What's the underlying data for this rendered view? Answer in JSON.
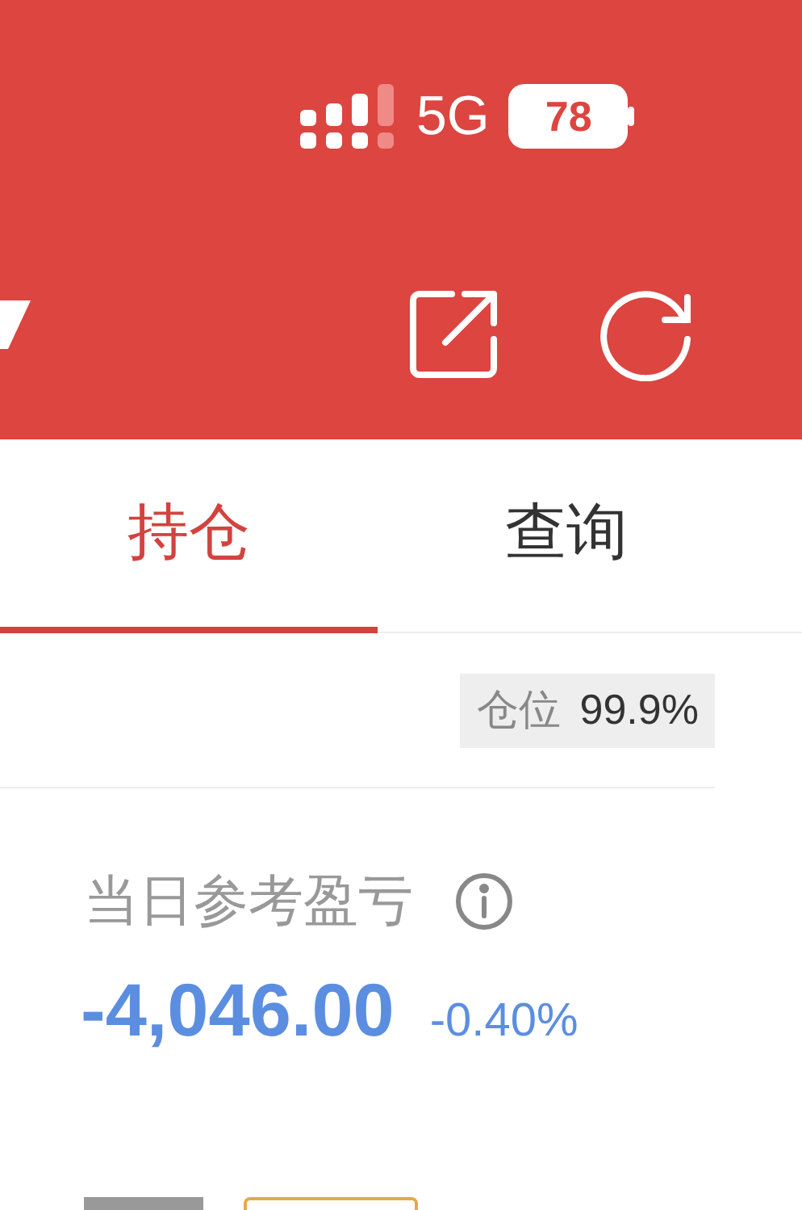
{
  "status_bar": {
    "network": "5G",
    "battery": "78"
  },
  "tabs": [
    {
      "label": "持仓",
      "selected": true
    },
    {
      "label": "查询",
      "selected": false
    }
  ],
  "position": {
    "label": "仓位",
    "value": "99.9%"
  },
  "daily_pnl": {
    "label": "当日参考盈亏",
    "amount": "-4,046.00",
    "percent": "-0.40%"
  }
}
